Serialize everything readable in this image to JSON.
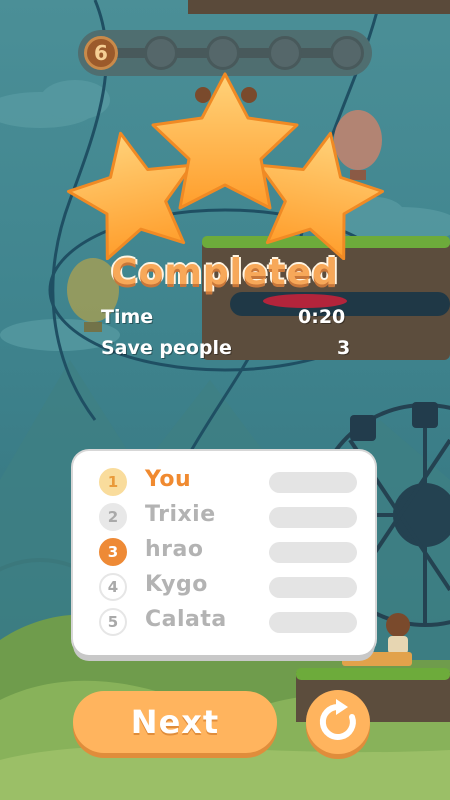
{
  "level_progress": {
    "current_level": "6",
    "total_steps": 5
  },
  "stars_earned": 3,
  "result": {
    "title": "Completed"
  },
  "stats": [
    {
      "label": "Time",
      "value": "0:20"
    },
    {
      "label": "Save people",
      "value": "3"
    }
  ],
  "leaderboard": [
    {
      "rank": "1",
      "name": "You",
      "highlight": true,
      "badge_color": "#f9dc9c",
      "text_color": "#f08a30"
    },
    {
      "rank": "2",
      "name": "Trixie",
      "highlight": false
    },
    {
      "rank": "3",
      "name": "hrao",
      "highlight": false,
      "badge_color": "#ee8a36",
      "badge_text": "#ffffff"
    },
    {
      "rank": "4",
      "name": "Kygo",
      "highlight": false
    },
    {
      "rank": "5",
      "name": "Calata",
      "highlight": false
    }
  ],
  "buttons": {
    "next_label": "Next",
    "replay_icon": "replay-icon"
  },
  "colors": {
    "accent": "#ffb45e",
    "title": "#f7a859",
    "star": "#ffb23c"
  }
}
